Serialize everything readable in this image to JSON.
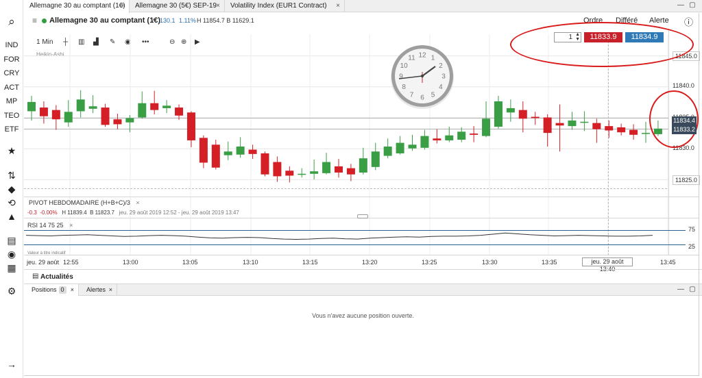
{
  "rail": {
    "search_icon": "⌕",
    "items": [
      "IND",
      "FOR",
      "CRY",
      "ACT",
      "MP",
      "TEO",
      "ETF"
    ],
    "icons": [
      {
        "name": "star-icon",
        "glyph": "★"
      },
      {
        "name": "swap-icon",
        "glyph": "⇅"
      },
      {
        "name": "tag-icon",
        "glyph": "◆"
      },
      {
        "name": "history-icon",
        "glyph": "⟲"
      },
      {
        "name": "alert-icon",
        "glyph": "▲"
      },
      {
        "name": "news-icon",
        "glyph": "▤"
      },
      {
        "name": "broadcast-icon",
        "glyph": "◉"
      },
      {
        "name": "calendar-icon",
        "glyph": "▦"
      },
      {
        "name": "settings-icon",
        "glyph": "⚙"
      },
      {
        "name": "expand-icon",
        "glyph": "→"
      }
    ]
  },
  "tabs": [
    {
      "label": "Allemagne 30 au comptant (1€)"
    },
    {
      "label": "Allemagne 30 (5€) SEP-19"
    },
    {
      "label": "Volatility Index (EUR1 Contract)"
    }
  ],
  "tab_close": "×",
  "window": {
    "min": "—",
    "max": "▢"
  },
  "header": {
    "name": "Allemagne 30 au comptant (1€)",
    "change": "130.1",
    "change_pct": "1.11%",
    "high_low": "H 11854.7 B 11629.1",
    "links": [
      "Ordre",
      "Différé",
      "Alerte"
    ],
    "info": "ⓘ"
  },
  "toolbar": {
    "interval": "1 Min",
    "chart_style": "Heikin-Ashi"
  },
  "order": {
    "quantity": "1",
    "sell": "11833.9",
    "buy": "11834.9"
  },
  "price_axis": [
    "11845.0",
    "11840.0",
    "11835.0",
    "11830.0",
    "11825.0"
  ],
  "price_tags": [
    "11834.4",
    "11833.2"
  ],
  "time_axis": [
    "jeu. 29 août",
    "12:55",
    "13:00",
    "13:05",
    "13:10",
    "13:15",
    "13:20",
    "13:25",
    "13:30",
    "13:35",
    "13:45"
  ],
  "time_cursor": "jeu. 29 août 13:40",
  "pivot": {
    "title": "PIVOT  HEBDOMADAIRE  (H+B+C)/3",
    "chg": "-0.3",
    "chg_pct": "-0.00%",
    "high": "H 11839.4",
    "low": "B 11823.7",
    "range": "jeu. 29 août 2019 12:52 - jeu. 29 août 2019 13:47"
  },
  "rsi": {
    "label": "RSI  14  75  25",
    "note": "Valeur à titre indicatif",
    "upper": "75",
    "lower": "25"
  },
  "news": {
    "label": "Actualités"
  },
  "panel_tabs": [
    {
      "label": "Positions",
      "count": "0"
    },
    {
      "label": "Alertes"
    }
  ],
  "empty_message": "Vous n'avez aucune position ouverte.",
  "chart_data": {
    "type": "candlestick",
    "ylim": [
      11823,
      11847
    ],
    "y_ticks": [
      11825,
      11830,
      11835,
      11840,
      11845
    ],
    "x_ticks": [
      "12:55",
      "13:00",
      "13:05",
      "13:10",
      "13:15",
      "13:20",
      "13:25",
      "13:30",
      "13:35",
      "13:40",
      "13:45"
    ],
    "last_bid": 11833.2,
    "last_ask": 11834.4,
    "candles": [
      {
        "o": 11836.0,
        "c": 11837.5,
        "h": 11838.5,
        "l": 11834.5
      },
      {
        "o": 11836.6,
        "c": 11835.2,
        "h": 11837.6,
        "l": 11834.0
      },
      {
        "o": 11836.2,
        "c": 11834.7,
        "h": 11837.0,
        "l": 11833.0
      },
      {
        "o": 11834.2,
        "c": 11835.9,
        "h": 11837.8,
        "l": 11833.5
      },
      {
        "o": 11836.0,
        "c": 11837.9,
        "h": 11839.4,
        "l": 11835.0
      },
      {
        "o": 11836.4,
        "c": 11836.8,
        "h": 11838.6,
        "l": 11835.7
      },
      {
        "o": 11836.6,
        "c": 11833.8,
        "h": 11837.2,
        "l": 11833.5
      },
      {
        "o": 11834.7,
        "c": 11833.9,
        "h": 11835.6,
        "l": 11833.1
      },
      {
        "o": 11834.2,
        "c": 11834.9,
        "h": 11835.4,
        "l": 11832.6
      },
      {
        "o": 11835.0,
        "c": 11837.3,
        "h": 11839.2,
        "l": 11834.8
      },
      {
        "o": 11837.3,
        "c": 11836.2,
        "h": 11839.3,
        "l": 11835.5
      },
      {
        "o": 11836.5,
        "c": 11836.9,
        "h": 11837.8,
        "l": 11835.7
      },
      {
        "o": 11836.6,
        "c": 11835.3,
        "h": 11837.1,
        "l": 11834.6
      },
      {
        "o": 11835.8,
        "c": 11831.3,
        "h": 11836.0,
        "l": 11830.2
      },
      {
        "o": 11831.7,
        "c": 11827.7,
        "h": 11832.1,
        "l": 11826.8
      },
      {
        "o": 11830.6,
        "c": 11826.9,
        "h": 11831.4,
        "l": 11826.6
      },
      {
        "o": 11828.9,
        "c": 11829.5,
        "h": 11831.1,
        "l": 11828.1
      },
      {
        "o": 11829.0,
        "c": 11830.3,
        "h": 11831.8,
        "l": 11828.5
      },
      {
        "o": 11829.8,
        "c": 11829.1,
        "h": 11830.6,
        "l": 11828.3
      },
      {
        "o": 11829.2,
        "c": 11825.8,
        "h": 11829.5,
        "l": 11825.5
      },
      {
        "o": 11827.8,
        "c": 11825.5,
        "h": 11828.7,
        "l": 11824.6
      },
      {
        "o": 11826.4,
        "c": 11825.6,
        "h": 11827.1,
        "l": 11824.5
      },
      {
        "o": 11825.8,
        "c": 11825.9,
        "h": 11826.8,
        "l": 11825.3
      },
      {
        "o": 11825.9,
        "c": 11826.3,
        "h": 11828.2,
        "l": 11825.0
      },
      {
        "o": 11826.0,
        "c": 11827.8,
        "h": 11829.3,
        "l": 11825.8
      },
      {
        "o": 11827.1,
        "c": 11826.1,
        "h": 11828.3,
        "l": 11825.3
      },
      {
        "o": 11826.8,
        "c": 11825.8,
        "h": 11827.5,
        "l": 11824.7
      },
      {
        "o": 11826.1,
        "c": 11828.4,
        "h": 11830.1,
        "l": 11825.8
      },
      {
        "o": 11827.0,
        "c": 11829.5,
        "h": 11830.9,
        "l": 11826.5
      },
      {
        "o": 11828.8,
        "c": 11830.3,
        "h": 11831.6,
        "l": 11828.4
      },
      {
        "o": 11829.2,
        "c": 11830.9,
        "h": 11832.0,
        "l": 11829.0
      },
      {
        "o": 11830.0,
        "c": 11830.6,
        "h": 11832.2,
        "l": 11829.6
      },
      {
        "o": 11830.1,
        "c": 11832.0,
        "h": 11833.0,
        "l": 11829.8
      },
      {
        "o": 11831.6,
        "c": 11831.3,
        "h": 11833.1,
        "l": 11830.8
      },
      {
        "o": 11831.3,
        "c": 11832.1,
        "h": 11833.5,
        "l": 11831.0
      },
      {
        "o": 11831.4,
        "c": 11832.7,
        "h": 11833.4,
        "l": 11831.0
      },
      {
        "o": 11832.4,
        "c": 11832.2,
        "h": 11833.6,
        "l": 11831.0
      },
      {
        "o": 11832.0,
        "c": 11834.8,
        "h": 11837.6,
        "l": 11831.8
      },
      {
        "o": 11833.5,
        "c": 11837.6,
        "h": 11838.5,
        "l": 11833.2
      },
      {
        "o": 11835.8,
        "c": 11836.5,
        "h": 11837.9,
        "l": 11834.3
      },
      {
        "o": 11836.2,
        "c": 11834.8,
        "h": 11837.6,
        "l": 11832.6
      },
      {
        "o": 11835.1,
        "c": 11834.9,
        "h": 11835.9,
        "l": 11833.8
      },
      {
        "o": 11835.0,
        "c": 11832.5,
        "h": 11835.5,
        "l": 11830.3
      },
      {
        "o": 11834.1,
        "c": 11833.7,
        "h": 11837.1,
        "l": 11829.5
      },
      {
        "o": 11833.6,
        "c": 11834.5,
        "h": 11835.9,
        "l": 11833.0
      },
      {
        "o": 11834.3,
        "c": 11834.3,
        "h": 11836.0,
        "l": 11832.8
      },
      {
        "o": 11834.1,
        "c": 11833.1,
        "h": 11834.8,
        "l": 11830.9
      },
      {
        "o": 11833.6,
        "c": 11832.9,
        "h": 11834.5,
        "l": 11831.7
      },
      {
        "o": 11833.4,
        "c": 11832.6,
        "h": 11834.0,
        "l": 11832.1
      },
      {
        "o": 11833.0,
        "c": 11832.2,
        "h": 11833.9,
        "l": 11831.4
      },
      {
        "o": 11832.4,
        "c": 11832.5,
        "h": 11834.3,
        "l": 11830.9
      },
      {
        "o": 11832.3,
        "c": 11833.2,
        "h": 11834.5,
        "l": 11832.0
      }
    ],
    "rsi": [
      58,
      57,
      56,
      58,
      59,
      60,
      58,
      56,
      54,
      55,
      57,
      58,
      57,
      55,
      52,
      49,
      48,
      50,
      51,
      50,
      47,
      45,
      44,
      45,
      47,
      48,
      46,
      45,
      48,
      50,
      52,
      53,
      52,
      54,
      55,
      55,
      56,
      58,
      62,
      66,
      63,
      60,
      58,
      56,
      57,
      58,
      57,
      56,
      55,
      55,
      56,
      58
    ]
  }
}
